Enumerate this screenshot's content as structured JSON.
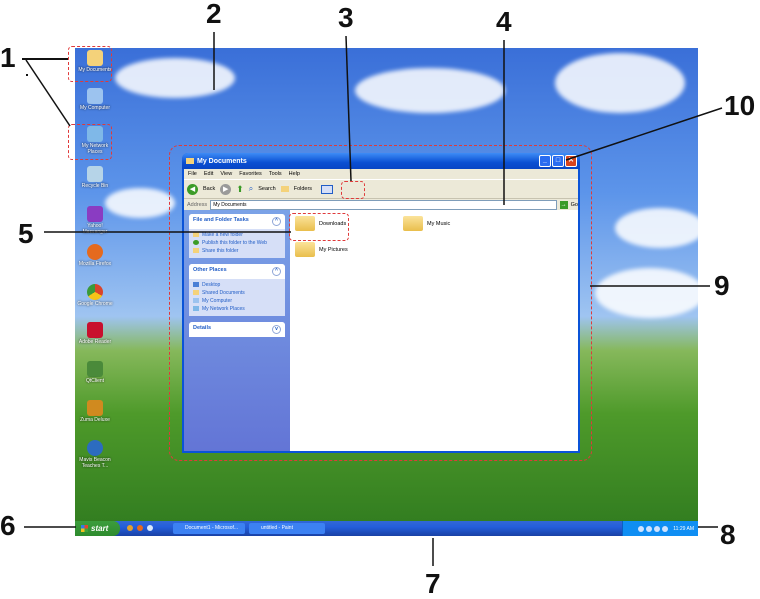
{
  "callouts": [
    "1",
    "2",
    "3",
    "4",
    "5",
    "6",
    "7",
    "8",
    "9",
    "10"
  ],
  "desktop_icons": [
    {
      "label": "My Documents",
      "icon": "my-documents-icon",
      "color": "#f4d27a"
    },
    {
      "label": "My Computer",
      "icon": "my-computer-icon",
      "color": "#9cc3ef"
    },
    {
      "label": "My Network Places",
      "icon": "network-places-icon",
      "color": "#7fb8e8"
    },
    {
      "label": "Recycle Bin",
      "icon": "recycle-bin-icon",
      "color": "#b6d4e8"
    },
    {
      "label": "Yahoo! Messenger",
      "icon": "messenger-icon",
      "color": "#8a3cc2"
    },
    {
      "label": "Mozilla Firefox",
      "icon": "firefox-icon",
      "color": "#e56a1e"
    },
    {
      "label": "Google Chrome",
      "icon": "chrome-icon",
      "color": "#d9442c"
    },
    {
      "label": "Adobe Reader",
      "icon": "adobe-reader-icon",
      "color": "#c8102e"
    },
    {
      "label": "QtClient",
      "icon": "qtclient-icon",
      "color": "#4a8a3a"
    },
    {
      "label": "Zuma Deluxe",
      "icon": "zuma-icon",
      "color": "#d08a1f"
    },
    {
      "label": "Mavis Beacon Teaches T...",
      "icon": "mavis-beacon-icon",
      "color": "#2c6cc0"
    }
  ],
  "window": {
    "title": "My Documents",
    "menu": [
      "File",
      "Edit",
      "View",
      "Favorites",
      "Tools",
      "Help"
    ],
    "toolbar": {
      "back": "Back",
      "search": "Search",
      "folders": "Folders"
    },
    "address_label": "Address",
    "address_value": "My Documents",
    "go_label": "Go",
    "file_tasks": {
      "title": "File and Folder Tasks",
      "items": [
        "Make a new folder",
        "Publish this folder to the Web",
        "Share this folder"
      ]
    },
    "other_places": {
      "title": "Other Places",
      "items": [
        "Desktop",
        "Shared Documents",
        "My Computer",
        "My Network Places"
      ]
    },
    "details": {
      "title": "Details"
    },
    "files": [
      "Downloads",
      "My Music",
      "My Pictures"
    ]
  },
  "taskbar": {
    "start_label": "start",
    "buttons": [
      "Document1 - Microsof...",
      "untitled - Paint"
    ],
    "clock": "11:29 AM"
  },
  "colors": {
    "highlight": "#e03a3a",
    "xp_blue": "#245edb",
    "start_green": "#3c9d3c"
  }
}
